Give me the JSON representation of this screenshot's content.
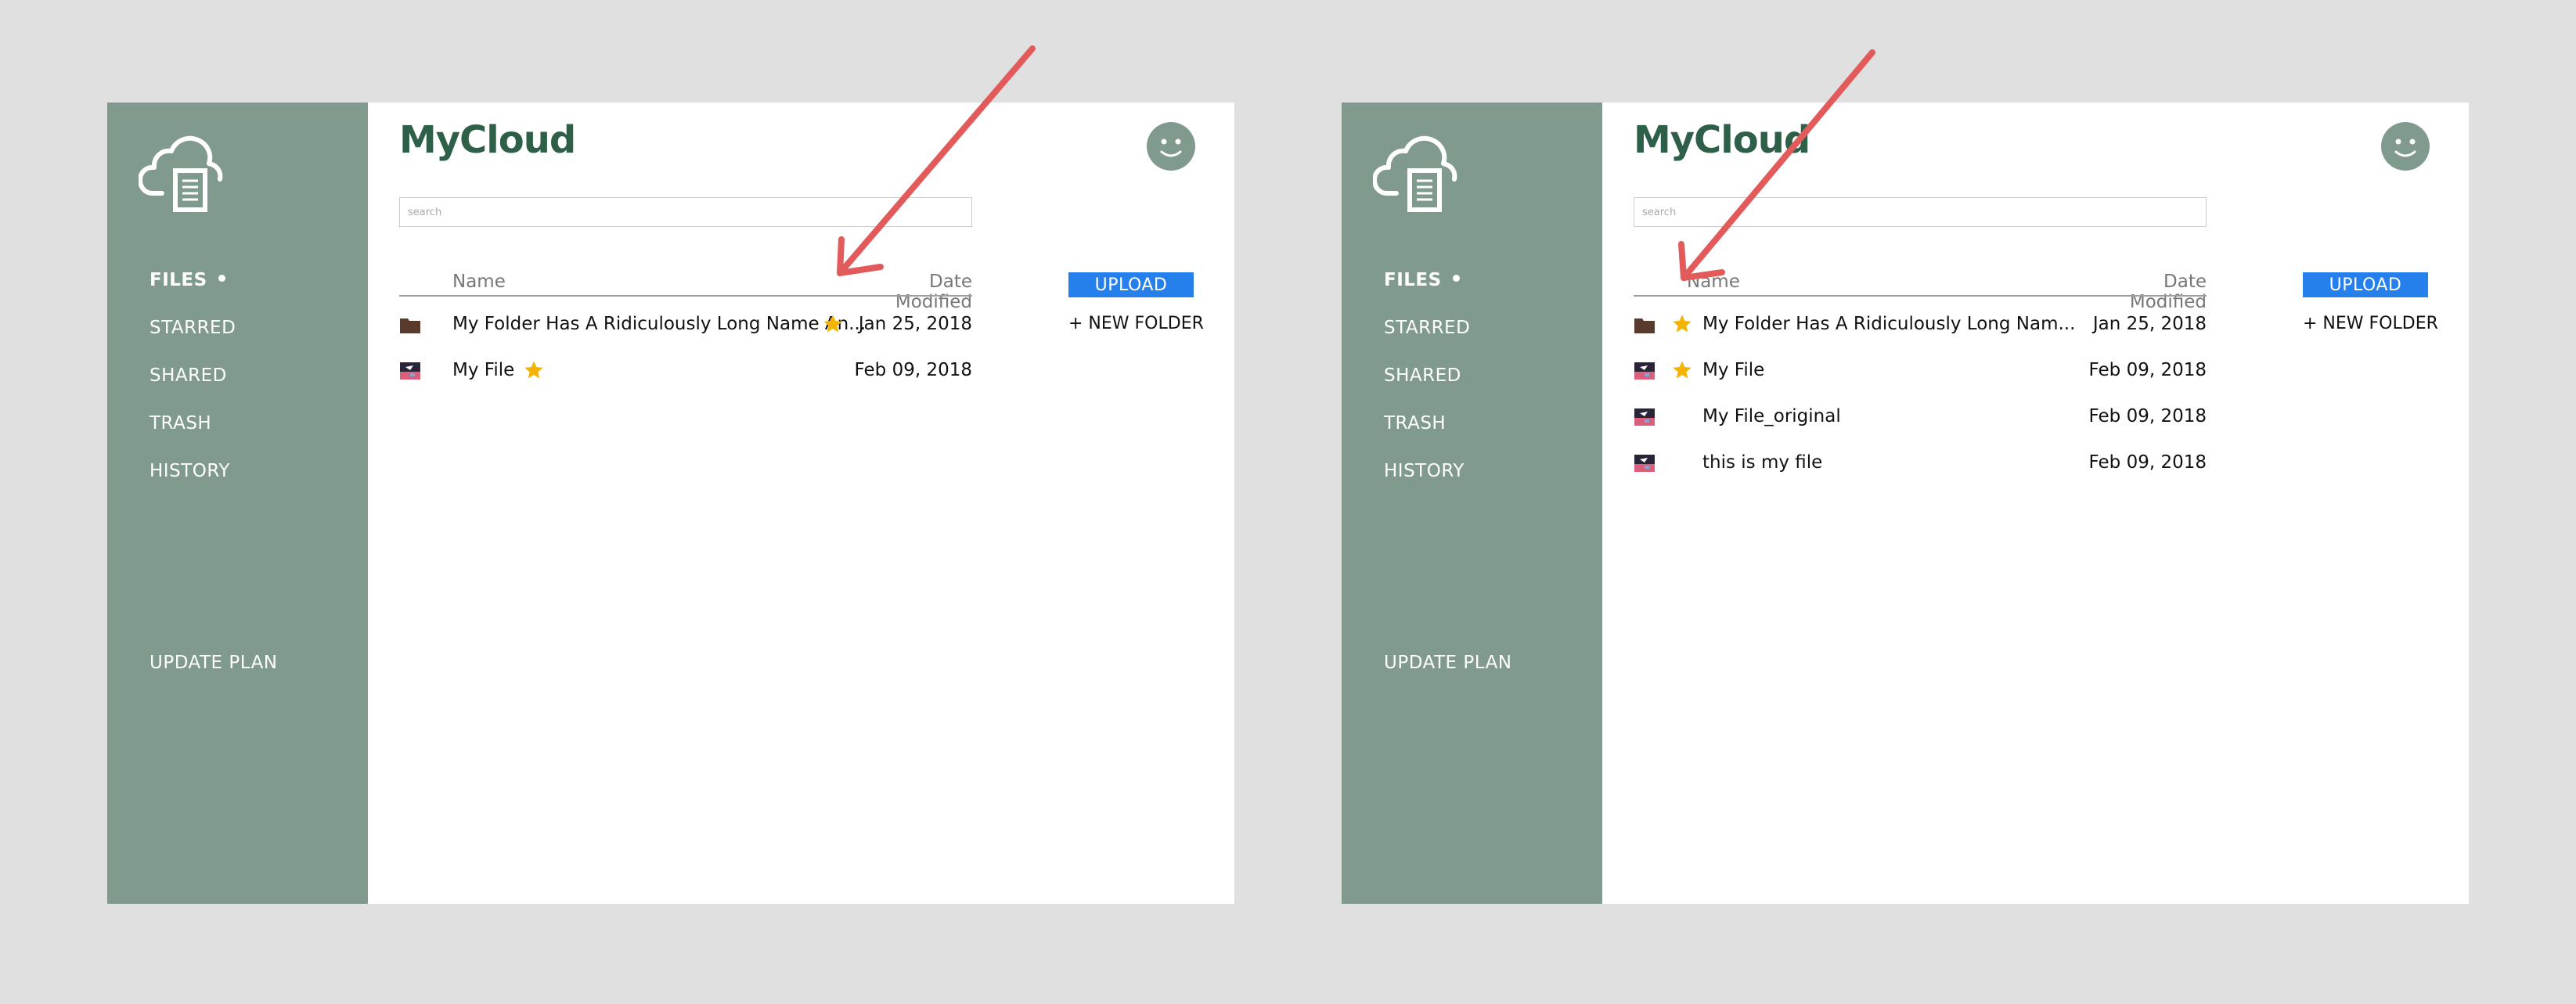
{
  "colors": {
    "sidebar": "#819a8e",
    "brand": "#2e5f48",
    "upload": "#2680eb",
    "star": "#f4b400",
    "folder": "#5b3a2e",
    "arrow": "#e25a5a"
  },
  "panels": [
    {
      "brand": "MyCloud",
      "search_placeholder": "search",
      "nav": {
        "files": "FILES",
        "starred": "STARRED",
        "shared": "SHARED",
        "trash": "TRASH",
        "history": "HISTORY",
        "update_plan": "UPDATE PLAN"
      },
      "columns": {
        "name": "Name",
        "date": "Date Modified"
      },
      "actions": {
        "upload": "UPLOAD",
        "new_folder": "+ NEW FOLDER"
      },
      "rows": [
        {
          "icon": "folder-icon",
          "name": "My Folder Has A Ridiculously Long Name An...",
          "date": "Jan 25, 2018",
          "starred": true
        },
        {
          "icon": "image-file-icon",
          "name": "My File",
          "date": "Feb 09, 2018",
          "starred": true
        }
      ]
    },
    {
      "brand": "MyCloud",
      "search_placeholder": "search",
      "nav": {
        "files": "FILES",
        "starred": "STARRED",
        "shared": "SHARED",
        "trash": "TRASH",
        "history": "HISTORY",
        "update_plan": "UPDATE PLAN"
      },
      "columns": {
        "name": "Name",
        "date": "Date Modified"
      },
      "actions": {
        "upload": "UPLOAD",
        "new_folder": "+ NEW FOLDER"
      },
      "rows": [
        {
          "icon": "folder-icon",
          "name": "My Folder Has A Ridiculously Long Nam...",
          "date": "Jan 25, 2018",
          "starred": true
        },
        {
          "icon": "image-file-icon",
          "name": "My File",
          "date": "Feb 09, 2018",
          "starred": true
        },
        {
          "icon": "image-file-icon",
          "name": "My File_original",
          "date": "Feb 09, 2018",
          "starred": false
        },
        {
          "icon": "image-file-icon",
          "name": "this is my file",
          "date": "Feb 09, 2018",
          "starred": false
        }
      ]
    }
  ]
}
